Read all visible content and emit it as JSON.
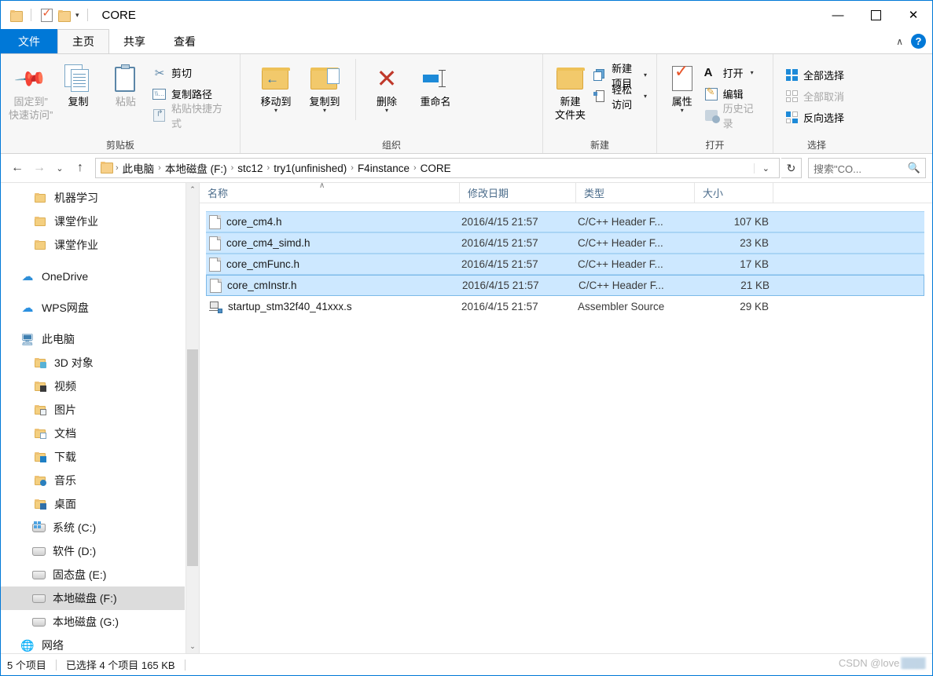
{
  "window": {
    "title": "CORE",
    "quick_access": [
      {
        "name": "properties-check",
        "icon": "document-check-icon"
      },
      {
        "name": "new-folder",
        "icon": "folder-icon"
      }
    ],
    "controls": {
      "minimize": "—",
      "maximize": "☐",
      "close": "✕"
    }
  },
  "tabs": [
    {
      "label": "文件",
      "name": "tab-file",
      "kind": "file"
    },
    {
      "label": "主页",
      "name": "tab-home",
      "kind": "active"
    },
    {
      "label": "共享",
      "name": "tab-share",
      "kind": "normal"
    },
    {
      "label": "查看",
      "name": "tab-view",
      "kind": "normal"
    }
  ],
  "tabbar_right": {
    "collapse_ribbon": "∧",
    "help": "?"
  },
  "ribbon": {
    "groups": [
      {
        "label": "剪贴板",
        "name": "group-clipboard",
        "big": [
          {
            "label": "固定到”快速访问”",
            "line1": "固定到”",
            "line2": "快速访问”",
            "icon": "pin-icon",
            "disabled": true
          },
          {
            "label": "复制",
            "icon": "copy-icon",
            "disabled": false
          },
          {
            "label": "粘贴",
            "icon": "paste-icon",
            "disabled": true
          }
        ],
        "small": [
          {
            "label": "剪切",
            "icon": "scissors-icon",
            "disabled": false
          },
          {
            "label": "复制路径",
            "icon": "copy-path-icon",
            "disabled": false
          },
          {
            "label": "粘贴快捷方式",
            "icon": "paste-shortcut-icon",
            "disabled": true
          }
        ]
      },
      {
        "label": "组织",
        "name": "group-organize",
        "big": [
          {
            "label": "移动到",
            "icon": "move-to-icon",
            "dropdown": true
          },
          {
            "label": "复制到",
            "icon": "copy-to-icon",
            "dropdown": true
          },
          {
            "label": "删除",
            "icon": "delete-icon",
            "dropdown": true
          },
          {
            "label": "重命名",
            "icon": "rename-icon",
            "dropdown": false
          }
        ]
      },
      {
        "label": "新建",
        "name": "group-new",
        "big": [
          {
            "label": "新建文件夹",
            "line1": "新建",
            "line2": "文件夹",
            "icon": "new-folder-icon"
          }
        ],
        "small": [
          {
            "label": "新建项目",
            "icon": "new-item-icon",
            "dropdown": true
          },
          {
            "label": "轻松访问",
            "icon": "easy-access-icon",
            "dropdown": true
          }
        ]
      },
      {
        "label": "打开",
        "name": "group-open",
        "big": [
          {
            "label": "属性",
            "icon": "properties-icon",
            "dropdown": true
          }
        ],
        "small": [
          {
            "label": "打开",
            "icon": "open-with-icon",
            "dropdown": true
          },
          {
            "label": "编辑",
            "icon": "edit-icon",
            "dropdown": false
          },
          {
            "label": "历史记录",
            "icon": "history-icon",
            "disabled": true
          }
        ]
      },
      {
        "label": "选择",
        "name": "group-select",
        "small": [
          {
            "label": "全部选择",
            "icon": "select-all-icon"
          },
          {
            "label": "全部取消",
            "icon": "select-none-icon",
            "disabled": true
          },
          {
            "label": "反向选择",
            "icon": "invert-selection-icon"
          }
        ]
      }
    ]
  },
  "address": {
    "back": "←",
    "forward": "→",
    "recent": "⌄",
    "up": "↑",
    "crumbs": [
      "此电脑",
      "本地磁盘 (F:)",
      "stc12",
      "try1(unfinished)",
      "F4instance",
      "CORE"
    ],
    "separator": "›",
    "dropdown": "⌄",
    "refresh": "↻",
    "search_placeholder": "搜索\"CO...",
    "search_icon": "search-icon"
  },
  "sidebar": {
    "items": [
      {
        "label": "机器学习",
        "icon": "folder-icon",
        "indent": 2,
        "selected": false
      },
      {
        "label": "课堂作业",
        "icon": "folder-icon",
        "indent": 2,
        "selected": false
      },
      {
        "label": "课堂作业",
        "icon": "folder-icon",
        "indent": 2,
        "selected": false
      },
      {
        "gap": true
      },
      {
        "label": "OneDrive",
        "icon": "onedrive-cloud-icon",
        "indent": 1,
        "selected": false
      },
      {
        "gap": true
      },
      {
        "label": "WPS网盘",
        "icon": "wps-cloud-icon",
        "indent": 1,
        "selected": false
      },
      {
        "gap": true
      },
      {
        "label": "此电脑",
        "icon": "this-pc-icon",
        "indent": 1,
        "selected": false
      },
      {
        "label": "3D 对象",
        "icon": "folder-3d-icon",
        "indent": 2,
        "selected": false
      },
      {
        "label": "视频",
        "icon": "folder-video-icon",
        "indent": 2,
        "selected": false
      },
      {
        "label": "图片",
        "icon": "folder-pictures-icon",
        "indent": 2,
        "selected": false
      },
      {
        "label": "文档",
        "icon": "folder-documents-icon",
        "indent": 2,
        "selected": false
      },
      {
        "label": "下载",
        "icon": "folder-downloads-icon",
        "indent": 2,
        "selected": false
      },
      {
        "label": "音乐",
        "icon": "folder-music-icon",
        "indent": 2,
        "selected": false
      },
      {
        "label": "桌面",
        "icon": "folder-desktop-icon",
        "indent": 2,
        "selected": false
      },
      {
        "label": "系统 (C:)",
        "icon": "system-drive-icon",
        "indent": 2,
        "selected": false
      },
      {
        "label": "软件 (D:)",
        "icon": "drive-icon",
        "indent": 2,
        "selected": false
      },
      {
        "label": "固态盘 (E:)",
        "icon": "drive-icon",
        "indent": 2,
        "selected": false
      },
      {
        "label": "本地磁盘 (F:)",
        "icon": "drive-icon",
        "indent": 2,
        "selected": true
      },
      {
        "label": "本地磁盘 (G:)",
        "icon": "drive-icon",
        "indent": 2,
        "selected": false
      },
      {
        "label": "网络",
        "icon": "network-icon",
        "indent": 1,
        "selected": false
      }
    ],
    "scroll_up": "⌃",
    "scroll_down": "⌄"
  },
  "filelist": {
    "columns": [
      {
        "label": "名称",
        "name": "column-name"
      },
      {
        "label": "修改日期",
        "name": "column-date-modified"
      },
      {
        "label": "类型",
        "name": "column-type"
      },
      {
        "label": "大小",
        "name": "column-size"
      }
    ],
    "sort_indicator": "∧",
    "rows": [
      {
        "name": "core_cm4.h",
        "date": "2016/4/15 21:57",
        "type": "C/C++ Header F...",
        "size": "107 KB",
        "icon": "header-file-icon",
        "selected": true
      },
      {
        "name": "core_cm4_simd.h",
        "date": "2016/4/15 21:57",
        "type": "C/C++ Header F...",
        "size": "23 KB",
        "icon": "header-file-icon",
        "selected": true
      },
      {
        "name": "core_cmFunc.h",
        "date": "2016/4/15 21:57",
        "type": "C/C++ Header F...",
        "size": "17 KB",
        "icon": "header-file-icon",
        "selected": true
      },
      {
        "name": "core_cmInstr.h",
        "date": "2016/4/15 21:57",
        "type": "C/C++ Header F...",
        "size": "21 KB",
        "icon": "header-file-icon",
        "selected": true,
        "focused": true
      },
      {
        "name": "startup_stm32f40_41xxx.s",
        "date": "2016/4/15 21:57",
        "type": "Assembler Source",
        "size": "29 KB",
        "icon": "assembler-file-icon",
        "selected": false
      }
    ]
  },
  "statusbar": {
    "item_count": "5 个项目",
    "selection": "已选择 4 个项目  165 KB",
    "watermark": "CSDN @love"
  }
}
